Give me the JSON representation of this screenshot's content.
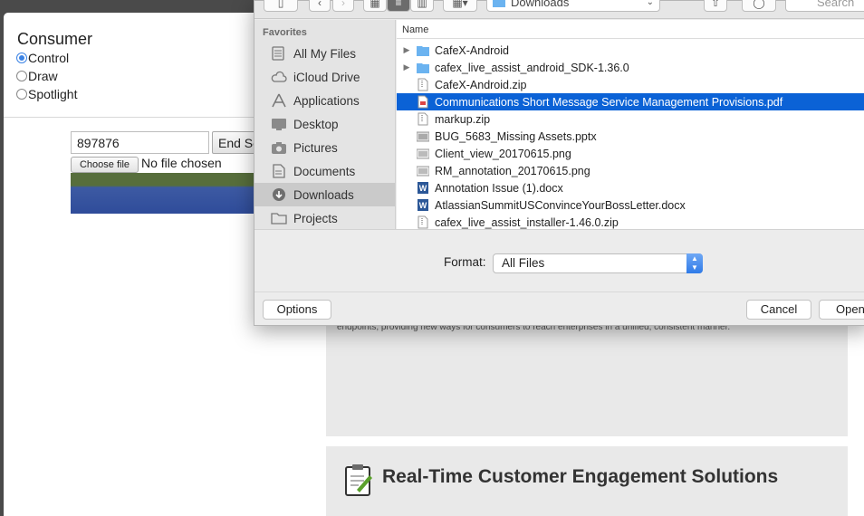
{
  "consumer": {
    "title": "Consumer",
    "modes": [
      {
        "label": "Control",
        "checked": true
      },
      {
        "label": "Draw",
        "checked": false
      },
      {
        "label": "Spotlight",
        "checked": false
      }
    ],
    "session_value": "897876",
    "end_button_label": "End Se",
    "choose_file_label": "Choose file",
    "no_file_label": "No file chosen"
  },
  "page": {
    "promo_text": "endpoints, providing new ways for consumers to reach enterprises in a unified, consistent manner.",
    "solutions_title": "Real-Time Customer Engagement Solutions"
  },
  "dialog": {
    "location": "Downloads",
    "search_placeholder": "Search",
    "favorites_label": "Favorites",
    "sidebar": [
      {
        "label": "All My Files",
        "icon": "all-files-icon",
        "selected": false
      },
      {
        "label": "iCloud Drive",
        "icon": "cloud-icon",
        "selected": false
      },
      {
        "label": "Applications",
        "icon": "applications-icon",
        "selected": false
      },
      {
        "label": "Desktop",
        "icon": "desktop-icon",
        "selected": false
      },
      {
        "label": "Pictures",
        "icon": "camera-icon",
        "selected": false
      },
      {
        "label": "Documents",
        "icon": "documents-icon",
        "selected": false
      },
      {
        "label": "Downloads",
        "icon": "download-icon",
        "selected": true
      },
      {
        "label": "Projects",
        "icon": "folder-icon",
        "selected": false
      }
    ],
    "column_name": "Name",
    "files": [
      {
        "name": "CafeX-Android",
        "kind": "folder",
        "expandable": true,
        "selected": false
      },
      {
        "name": "cafex_live_assist_android_SDK-1.36.0",
        "kind": "folder",
        "expandable": true,
        "selected": false
      },
      {
        "name": "CafeX-Android.zip",
        "kind": "zip",
        "expandable": false,
        "selected": false
      },
      {
        "name": "Communications Short Message Service Management Provisions.pdf",
        "kind": "pdf",
        "expandable": false,
        "selected": true
      },
      {
        "name": "markup.zip",
        "kind": "zip",
        "expandable": false,
        "selected": false
      },
      {
        "name": "BUG_5683_Missing Assets.pptx",
        "kind": "pptx",
        "expandable": false,
        "selected": false
      },
      {
        "name": "Client_view_20170615.png",
        "kind": "png",
        "expandable": false,
        "selected": false
      },
      {
        "name": "RM_annotation_20170615.png",
        "kind": "png",
        "expandable": false,
        "selected": false
      },
      {
        "name": "Annotation Issue (1).docx",
        "kind": "docx",
        "expandable": false,
        "selected": false
      },
      {
        "name": "AtlassianSummitUSConvinceYourBossLetter.docx",
        "kind": "docx",
        "expandable": false,
        "selected": false
      },
      {
        "name": "cafex_live_assist_installer-1.46.0.zip",
        "kind": "zip",
        "expandable": false,
        "selected": false
      }
    ],
    "format_label": "Format:",
    "format_value": "All Files",
    "options_label": "Options",
    "cancel_label": "Cancel",
    "open_label": "Open"
  },
  "colors": {
    "selection": "#0b62d6",
    "accent": "#3b83e5"
  }
}
